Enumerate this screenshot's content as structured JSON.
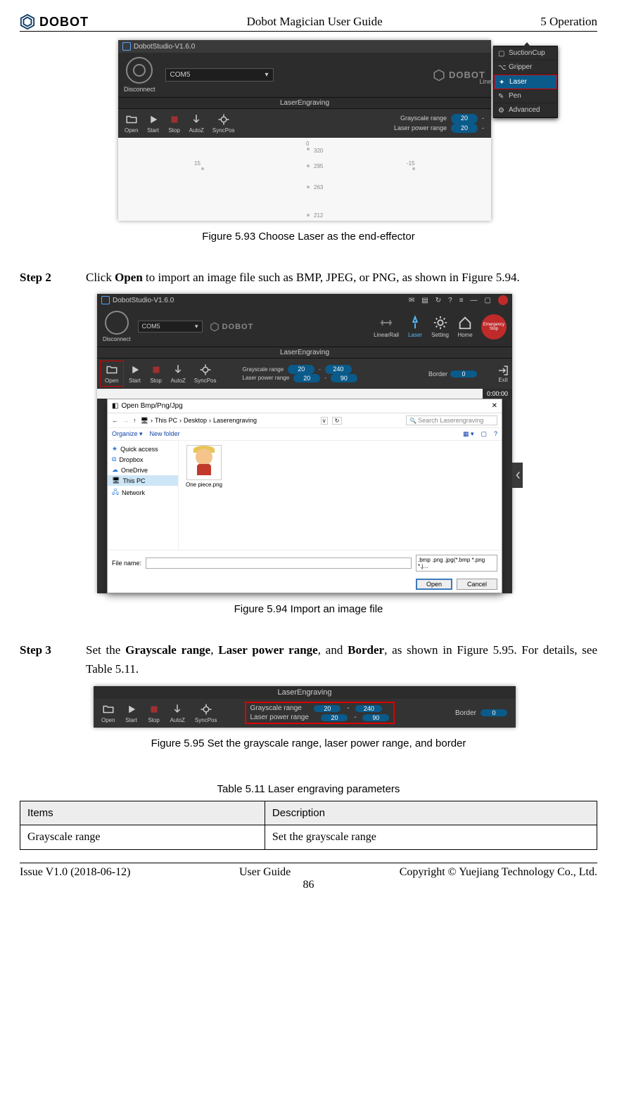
{
  "header": {
    "brand": "DOBOT",
    "center": "Dobot Magician User Guide",
    "right": "5 Operation"
  },
  "fig93": {
    "title": "DobotStudio-V1.6.0",
    "disconnect": "Disconnect",
    "port": "COM5",
    "brand": "DOBOT",
    "linear": "LinearRail",
    "menu": [
      "SuctionCup",
      "Gripper",
      "Laser",
      "Pen",
      "Advanced"
    ],
    "mid": "LaserEngraving",
    "toolbar": {
      "open": "Open",
      "start": "Start",
      "stop": "Stop",
      "autoz": "AutoZ",
      "syncpos": "SyncPos"
    },
    "ranges": {
      "gray_lbl": "Grayscale  range",
      "laser_lbl": "Laser power range",
      "v1": "20",
      "v2": "20"
    },
    "arc": {
      "p0": "0",
      "p15": "15",
      "pm15": "-15",
      "y320": "320",
      "y295": "295",
      "y263": "263",
      "y212": "212"
    },
    "caption": "Figure 5.93    Choose Laser as the end-effector"
  },
  "step2": {
    "label": "Step 2",
    "body_pre": "Click ",
    "body_bold": "Open",
    "body_post": " to import an image file such as BMP, JPEG, or PNG, as shown in Figure 5.94."
  },
  "fig94": {
    "title": "DobotStudio-V1.6.0",
    "disconnect": "Disconnect",
    "port": "COM5",
    "brand": "DOBOT",
    "linear": "LinearRail",
    "laser": "Laser",
    "setting": "Setting",
    "home": "Home",
    "estop1": "Emergency",
    "estop2": "Stop",
    "mid": "LaserEngraving",
    "toolbar": {
      "open": "Open",
      "start": "Start",
      "stop": "Stop",
      "autoz": "AutoZ",
      "syncpos": "SyncPos",
      "exit": "Exit"
    },
    "ranges": {
      "gray_lbl": "Grayscale  range",
      "laser_lbl": "Laser power range",
      "g1": "20",
      "g2": "240",
      "l1": "20",
      "l2": "90"
    },
    "border_lbl": "Border",
    "border_val": "0",
    "timer": "0:00:00",
    "dialog": {
      "title": "Open Bmp/Png/Jpg",
      "crumb": [
        "This PC",
        "Desktop",
        "Laserengraving"
      ],
      "search": "Search Laserengraving",
      "org": "Organize ▾",
      "newf": "New folder",
      "side": [
        "Quick access",
        "Dropbox",
        "OneDrive",
        "This PC",
        "Network"
      ],
      "thumb": "One piece.png",
      "fname_lbl": "File name:",
      "filter": ".bmp .png .jpg(*.bmp *.png *.j…",
      "open": "Open",
      "cancel": "Cancel"
    },
    "caption": "Figure 5.94    Import an image file"
  },
  "step3": {
    "label": "Step 3",
    "t1": "Set the ",
    "b1": "Grayscale range",
    "t2": ", ",
    "b2": "Laser power range",
    "t3": ", and ",
    "b3": "Border",
    "t4": ", as shown in Figure 5.95. For details, see Table 5.11."
  },
  "fig95": {
    "mid": "LaserEngraving",
    "toolbar": {
      "open": "Open",
      "start": "Start",
      "stop": "Stop",
      "autoz": "AutoZ",
      "syncpos": "SyncPos"
    },
    "ranges": {
      "gray_lbl": "Grayscale  range",
      "laser_lbl": "Laser power range",
      "g1": "20",
      "g2": "240",
      "l1": "20",
      "l2": "90"
    },
    "border_lbl": "Border",
    "border_val": "0",
    "caption": "Figure 5.95    Set the grayscale range, laser power range, and border"
  },
  "table": {
    "caption": "Table 5.11    Laser engraving parameters",
    "h1": "Items",
    "h2": "Description",
    "r1c1": "Grayscale range",
    "r1c2": "Set the grayscale range"
  },
  "footer": {
    "left": "Issue V1.0 (2018-06-12)",
    "center": "User Guide",
    "right": "Copyright © Yuejiang Technology Co., Ltd.",
    "page": "86"
  }
}
